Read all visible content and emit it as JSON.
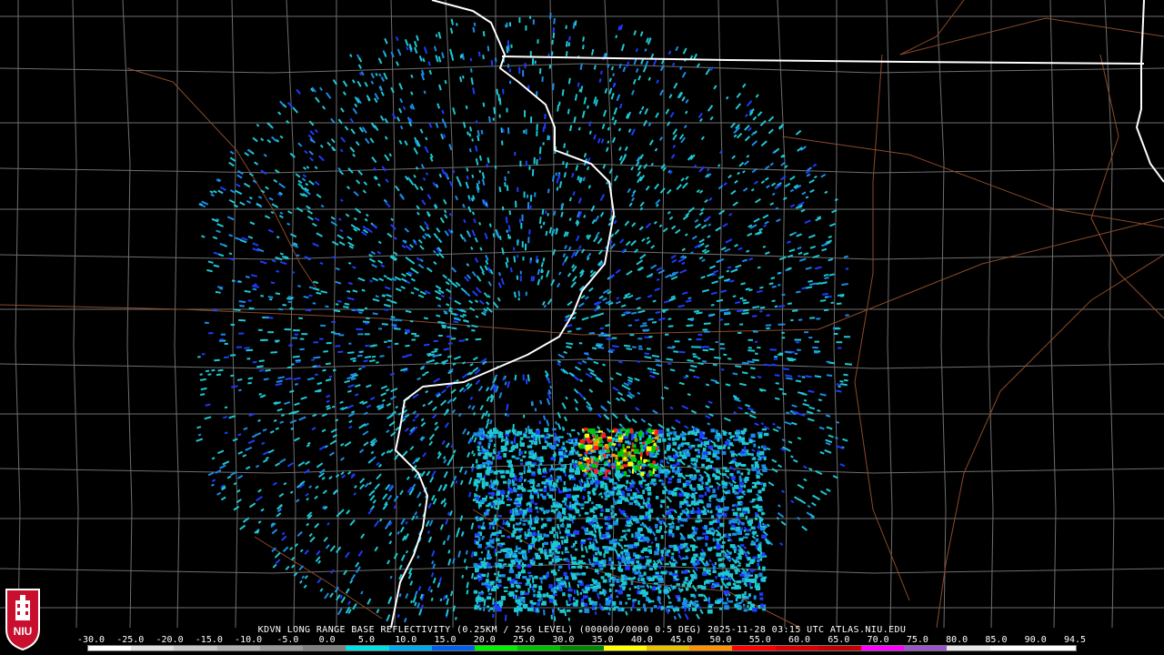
{
  "product": {
    "header": "KDVN LONG RANGE BASE REFLECTIVITY (0.25KM / 256 LEVEL) (000000/0000 0.5 DEG) 2025-11-28 03:15 UTC  ATLAS.NIU.EDU"
  },
  "scale": {
    "labels": [
      "-30.0",
      "-25.0",
      "-20.0",
      "-15.0",
      "-10.0",
      "-5.0",
      "0.0",
      "5.0",
      "10.0",
      "15.0",
      "20.0",
      "25.0",
      "30.0",
      "35.0",
      "40.0",
      "45.0",
      "50.0",
      "55.0",
      "60.0",
      "65.0",
      "70.0",
      "75.0",
      "80.0",
      "85.0",
      "90.0",
      "94.5"
    ],
    "colors": [
      "#ffffff",
      "#e0e0e0",
      "#c8c8c8",
      "#b0b0b0",
      "#989898",
      "#808080",
      "#00e0e0",
      "#00a8f0",
      "#0060f0",
      "#00f000",
      "#00c000",
      "#008800",
      "#ffff00",
      "#e8c000",
      "#ff9000",
      "#ff0000",
      "#d80000",
      "#c00000",
      "#ff00ff",
      "#9955c9",
      "#e8e8e8",
      "#ffffff",
      "#ffffff"
    ]
  },
  "logo": {
    "text": "NIU"
  },
  "map": {
    "colors": {
      "background": "#000000",
      "county_lines": "#6e6e6e",
      "state_lines": "#ffffff",
      "highways": "#8b4a2b",
      "echo_light": "#1ec8d2",
      "echo_mid": "#1a8ce6",
      "echo_blue": "#1e3cff",
      "echo_green": "#00c800",
      "echo_yellow": "#ffff00",
      "echo_orange": "#ff9600",
      "echo_red": "#ff1e1e"
    }
  }
}
